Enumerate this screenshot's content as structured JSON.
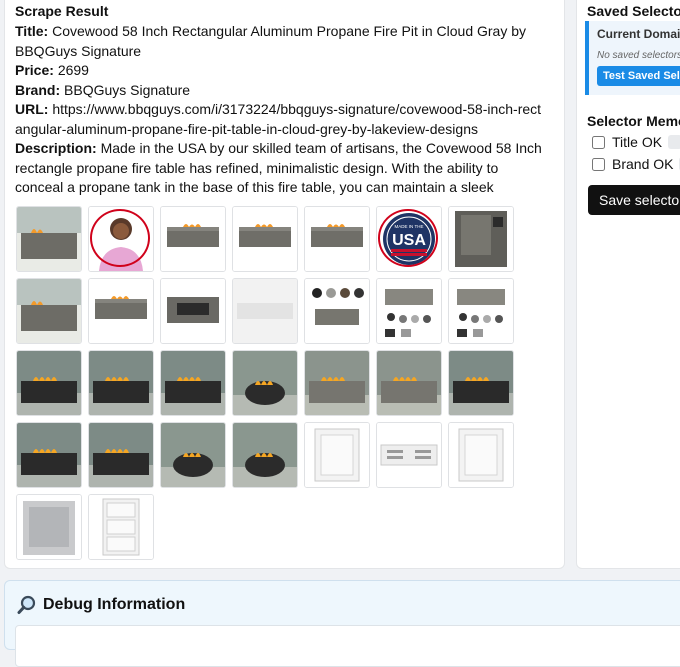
{
  "result": {
    "heading": "Scrape Result",
    "title_label": "Title:",
    "title_value": "Covewood 58 Inch Rectangular Aluminum Propane Fire Pit in Cloud Gray by BBQGuys Signature",
    "price_label": "Price:",
    "price_value": "2699",
    "brand_label": "Brand:",
    "brand_value": "BBQGuys Signature",
    "url_label": "URL:",
    "url_value": "https://www.bbqguys.com/i/3173224/bbqguys-signature/covewood-58-inch-rectangular-aluminum-propane-fire-pit-table-in-cloud-grey-by-lakeview-designs",
    "desc_label": "Description:",
    "desc_value": "Made in the USA by our skilled team of artisans, the Covewood 58 Inch rectangle propane fire table has refined, minimalistic design. With the ability to conceal a propane tank in the base of this fire table, you can maintain a sleek appeara",
    "thumbnails": [
      {
        "kind": "firepit-outdoor",
        "circled": false
      },
      {
        "kind": "person",
        "circled": true
      },
      {
        "kind": "firepit-plain",
        "circled": false
      },
      {
        "kind": "firepit-plain",
        "circled": false
      },
      {
        "kind": "firepit-plain",
        "circled": false
      },
      {
        "kind": "usa-badge",
        "circled": true,
        "text": "USA",
        "subtext": "MADE IN THE"
      },
      {
        "kind": "panel",
        "circled": false
      },
      {
        "kind": "firepit-outdoor",
        "circled": false
      },
      {
        "kind": "firepit-plain",
        "circled": false
      },
      {
        "kind": "firepit-top",
        "circled": false
      },
      {
        "kind": "firepit-light",
        "circled": false
      },
      {
        "kind": "colors",
        "circled": false
      },
      {
        "kind": "diagram",
        "circled": false
      },
      {
        "kind": "diagram",
        "circled": false
      },
      {
        "kind": "firepit-dark-scene",
        "circled": false
      },
      {
        "kind": "firepit-dark-scene",
        "circled": false
      },
      {
        "kind": "firepit-dark-scene",
        "circled": false
      },
      {
        "kind": "firepit-round-scene",
        "circled": false
      },
      {
        "kind": "firepit-gray-scene",
        "circled": false
      },
      {
        "kind": "firepit-gray-scene",
        "circled": false
      },
      {
        "kind": "firepit-dark-scene",
        "circled": false
      },
      {
        "kind": "firepit-dark-scene",
        "circled": false
      },
      {
        "kind": "firepit-dark-scene",
        "circled": false
      },
      {
        "kind": "firepit-round-scene",
        "circled": false
      },
      {
        "kind": "firepit-round-scene",
        "circled": false
      },
      {
        "kind": "door-white",
        "circled": false
      },
      {
        "kind": "vent",
        "circled": false
      },
      {
        "kind": "door-white",
        "circled": false
      },
      {
        "kind": "door-steel",
        "circled": false
      },
      {
        "kind": "drawers",
        "circled": false
      }
    ]
  },
  "side": {
    "heading": "Saved Selectors",
    "domain_label": "Current Domain",
    "domain_empty": "No saved selectors",
    "test_button": "Test Saved Selectors",
    "memory_heading": "Selector Memory",
    "title_ok": "Title OK",
    "brand_ok": "Brand OK",
    "save_button": "Save selectors"
  },
  "debug": {
    "heading": "Debug Information",
    "icon": "magnifier-icon"
  },
  "colors": {
    "accent": "#1a8be6",
    "circle": "#d0021b",
    "debug_bg": "#eef7fd"
  }
}
